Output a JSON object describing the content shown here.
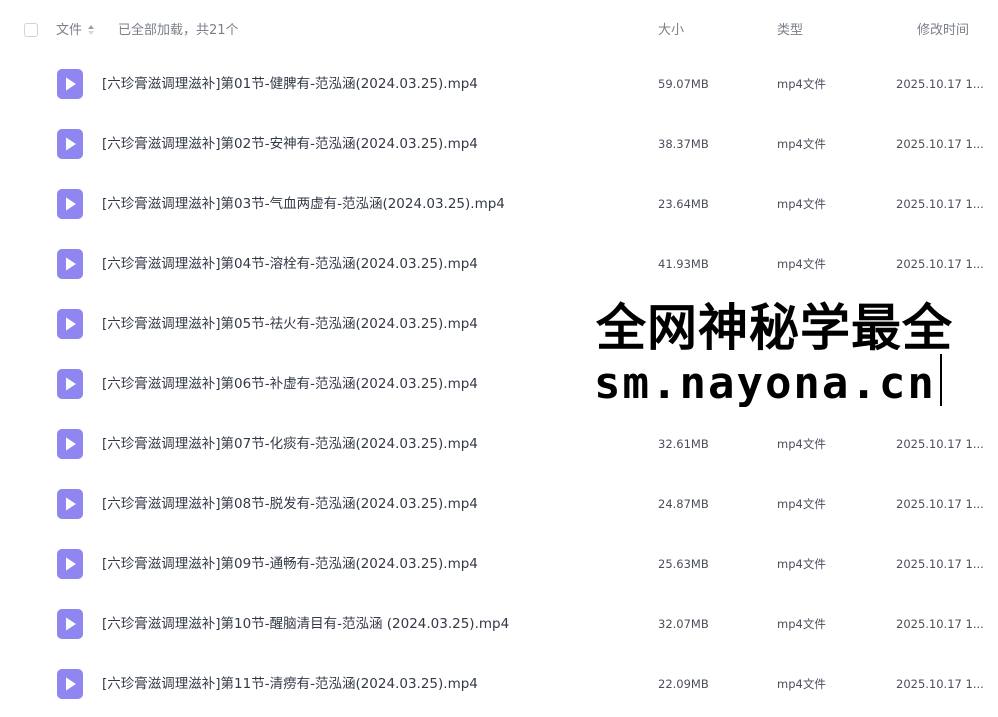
{
  "header": {
    "file_col": "文件",
    "loaded_text": "已全部加载，共21个",
    "size_col": "大小",
    "type_col": "类型",
    "modified_col": "修改时间"
  },
  "files": [
    {
      "name": "[六珍膏滋调理滋补]第01节-健脾有-范泓涵(2024.03.25).mp4",
      "size": "59.07MB",
      "type": "mp4文件",
      "modified": "2025.10.17 1..."
    },
    {
      "name": "[六珍膏滋调理滋补]第02节-安神有-范泓涵(2024.03.25).mp4",
      "size": "38.37MB",
      "type": "mp4文件",
      "modified": "2025.10.17 1..."
    },
    {
      "name": "[六珍膏滋调理滋补]第03节-气血两虚有-范泓涵(2024.03.25).mp4",
      "size": "23.64MB",
      "type": "mp4文件",
      "modified": "2025.10.17 1..."
    },
    {
      "name": "[六珍膏滋调理滋补]第04节-溶栓有-范泓涵(2024.03.25).mp4",
      "size": "41.93MB",
      "type": "mp4文件",
      "modified": "2025.10.17 1..."
    },
    {
      "name": "[六珍膏滋调理滋补]第05节-祛火有-范泓涵(2024.03.25).mp4",
      "size": "",
      "type": "",
      "modified": ""
    },
    {
      "name": "[六珍膏滋调理滋补]第06节-补虚有-范泓涵(2024.03.25).mp4",
      "size": "",
      "type": "",
      "modified": ""
    },
    {
      "name": "[六珍膏滋调理滋补]第07节-化痰有-范泓涵(2024.03.25).mp4",
      "size": "32.61MB",
      "type": "mp4文件",
      "modified": "2025.10.17 1..."
    },
    {
      "name": "[六珍膏滋调理滋补]第08节-脱发有-范泓涵(2024.03.25).mp4",
      "size": "24.87MB",
      "type": "mp4文件",
      "modified": "2025.10.17 1..."
    },
    {
      "name": "[六珍膏滋调理滋补]第09节-通畅有-范泓涵(2024.03.25).mp4",
      "size": "25.63MB",
      "type": "mp4文件",
      "modified": "2025.10.17 1..."
    },
    {
      "name": "[六珍膏滋调理滋补]第10节-醒脑清目有-范泓涵 (2024.03.25).mp4",
      "size": "32.07MB",
      "type": "mp4文件",
      "modified": "2025.10.17 1..."
    },
    {
      "name": "[六珍膏滋调理滋补]第11节-清痨有-范泓涵(2024.03.25).mp4",
      "size": "22.09MB",
      "type": "mp4文件",
      "modified": "2025.10.17 1..."
    }
  ],
  "watermark": {
    "line1": "全网神秘学最全",
    "line2": "sm.nayona.cn"
  },
  "colors": {
    "file_icon": "#8f86f2",
    "text": "#333946",
    "muted": "#7a7f89"
  },
  "icons": {
    "file": "video-file-icon",
    "sort": "sort-icon",
    "checkbox": "checkbox-icon"
  }
}
